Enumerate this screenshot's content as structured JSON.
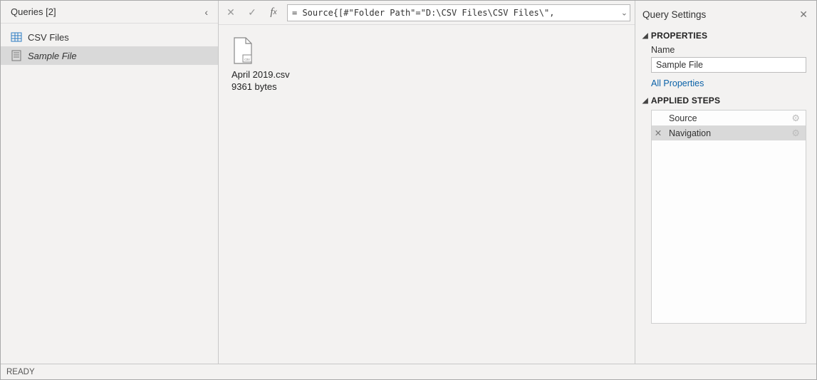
{
  "queries": {
    "header": "Queries [2]",
    "items": [
      {
        "label": "CSV Files",
        "icon": "table-icon",
        "selected": false,
        "italic": false
      },
      {
        "label": "Sample File",
        "icon": "doc-icon",
        "selected": true,
        "italic": true
      }
    ]
  },
  "formula": {
    "value": "= Source{[#\"Folder Path\"=\"D:\\CSV Files\\CSV Files\\\","
  },
  "preview": {
    "file_name": "April 2019.csv",
    "file_size": "9361 bytes"
  },
  "settings": {
    "title": "Query Settings",
    "properties_heading": "PROPERTIES",
    "name_label": "Name",
    "name_value": "Sample File",
    "all_properties": "All Properties",
    "steps_heading": "APPLIED STEPS",
    "steps": [
      {
        "label": "Source",
        "selected": false,
        "has_gear": true
      },
      {
        "label": "Navigation",
        "selected": true,
        "has_gear": true
      }
    ]
  },
  "status": {
    "text": "READY"
  }
}
